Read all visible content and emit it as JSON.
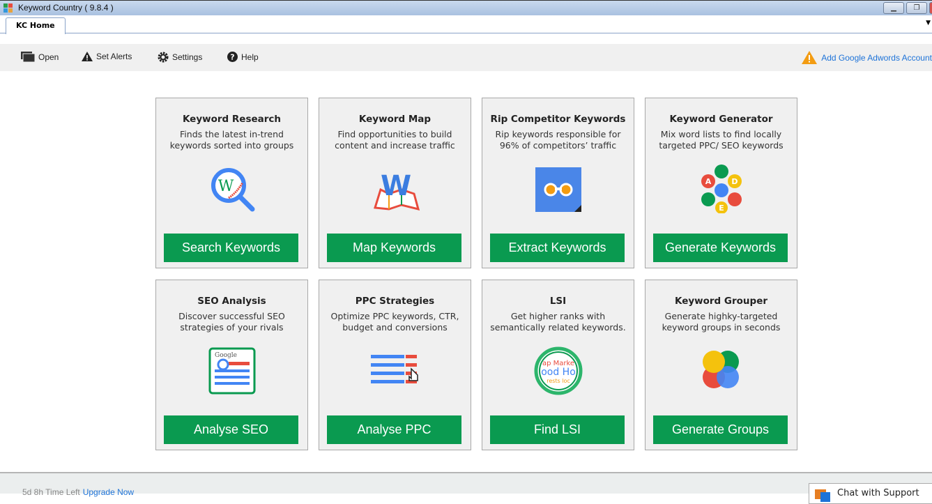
{
  "window": {
    "title": "Keyword Country ( 9.8.4 )"
  },
  "tabs": [
    {
      "label": "KC Home",
      "active": true
    }
  ],
  "toolbar": {
    "open": "Open",
    "set_alerts": "Set Alerts",
    "settings": "Settings",
    "help": "Help",
    "adwords": "Add Google Adwords Account"
  },
  "cards": [
    {
      "title": "Keyword Research",
      "desc": "Finds the latest in-trend\nkeywords sorted into groups",
      "button": "Search Keywords",
      "icon": "magnifier-wiki-icon"
    },
    {
      "title": "Keyword Map",
      "desc": "Find opportunities to build\ncontent and increase traffic",
      "button": "Map Keywords",
      "icon": "keyword-map-icon"
    },
    {
      "title": "Rip Competitor Keywords",
      "desc": "Rip keywords responsible for\n96% of competitors’ traffic",
      "button": "Extract Keywords",
      "icon": "binoculars-icon"
    },
    {
      "title": "Keyword Generator",
      "desc": "Mix word lists to find locally\ntargeted PPC/ SEO keywords",
      "button": "Generate Keywords",
      "icon": "hexagons-icon"
    },
    {
      "title": "SEO Analysis",
      "desc": "Discover successful SEO\nstrategies of your rivals",
      "button": "Analyse SEO",
      "icon": "google-serp-icon"
    },
    {
      "title": "PPC Strategies",
      "desc": "Optimize PPC keywords, CTR,\nbudget and conversions",
      "button": "Analyse PPC",
      "icon": "ppc-list-icon"
    },
    {
      "title": "LSI",
      "desc": "Get higher ranks with\nsemantically related keywords.",
      "button": "Find LSI",
      "icon": "lsi-lens-icon"
    },
    {
      "title": "Keyword Grouper",
      "desc": "Generate highky-targeted\nkeyword groups in seconds",
      "button": "Generate Groups",
      "icon": "circles-icon"
    }
  ],
  "footer": {
    "time_left": "5d 8h Time Left",
    "upgrade": "Upgrade Now",
    "chat": "Chat with Support"
  },
  "colors": {
    "button": "#0a9a50",
    "link": "#1e73d8",
    "warning": "#f39c12"
  }
}
